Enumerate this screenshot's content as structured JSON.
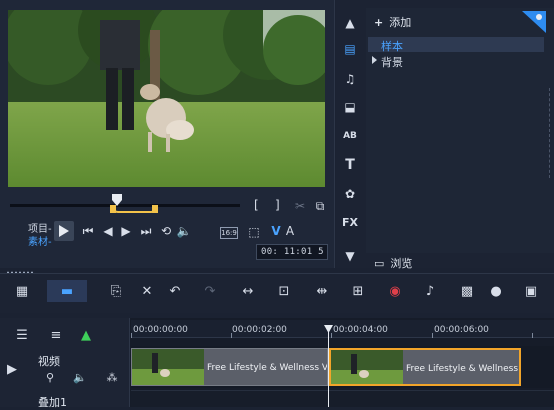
{
  "preview": {
    "mode_project": "项目-",
    "mode_clip": "素材-",
    "timecode": "00: 11:01 5",
    "hd_badge": "16:9",
    "mark_in": "[",
    "mark_out": "]"
  },
  "library": {
    "add_label": "添加",
    "items": [
      {
        "label": "样本",
        "selected": true
      },
      {
        "label": "背景",
        "selected": false
      }
    ],
    "browse_label": "浏览",
    "rail_icons": [
      "up-arrow-icon",
      "media-icon",
      "audio-icon",
      "instant-project-icon",
      "transition-icon",
      "title-icon",
      "graphics-icon",
      "fx-icon",
      "down-arrow-icon"
    ],
    "rail_text": {
      "ab": "AB",
      "title": "T",
      "fx": "FX"
    }
  },
  "toolbar": {
    "icons": [
      "storyboard-view-icon",
      "timeline-view-icon",
      "copy-icon",
      "tools-icon",
      "undo-icon",
      "redo-icon",
      "fit-icon",
      "subtitle-icon",
      "split-icon",
      "track-manager-icon",
      "record-icon",
      "audio-mixer-icon",
      "multi-camera-icon",
      "motion-icon",
      "title-editor-icon"
    ]
  },
  "timeline": {
    "ruler": [
      "00:00:00:00",
      "00:00:02:00",
      "00:00:04:00",
      "00:00:06:00"
    ],
    "tracks": [
      {
        "label": "视频"
      },
      {
        "label": "叠加1"
      }
    ],
    "clips": [
      {
        "title": "Free Lifestyle & Wellness Vide"
      },
      {
        "title": "Free Lifestyle & Wellness Vide"
      }
    ]
  },
  "colors": {
    "accent": "#4aa3ff",
    "trim": "#f2c24a",
    "selected_clip_border": "#f2a52a",
    "background": "#1b2232"
  }
}
